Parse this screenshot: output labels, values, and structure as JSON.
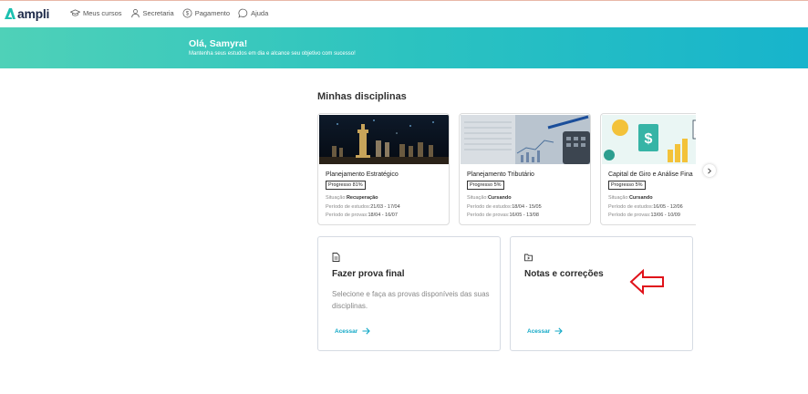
{
  "app": {
    "logo_text": "ampli"
  },
  "nav": {
    "items": [
      {
        "label": "Meus cursos",
        "icon": "graduation-cap-icon"
      },
      {
        "label": "Secretaria",
        "icon": "user-icon"
      },
      {
        "label": "Pagamento",
        "icon": "dollar-circle-icon"
      },
      {
        "label": "Ajuda",
        "icon": "chat-bubble-icon"
      }
    ]
  },
  "hero": {
    "title": "Olá, Samyra!",
    "subtitle": "Mantenha seus estudos em dia e alcance seu objetivo com sucesso!"
  },
  "disciplines": {
    "title": "Minhas disciplinas",
    "cards": [
      {
        "name": "Planejamento Estratégico",
        "progress": "Progresso 81%",
        "status_label": "Situação:",
        "status_value": "Recuperação",
        "study_label": "Período de estudos:",
        "study_value": "21/03 - 17/04",
        "exam_label": "Período de provas:",
        "exam_value": "18/04 - 16/07"
      },
      {
        "name": "Planejamento Tributário",
        "progress": "Progresso 5%",
        "status_label": "Situação:",
        "status_value": "Cursando",
        "study_label": "Período de estudos:",
        "study_value": "18/04 - 15/05",
        "exam_label": "Período de provas:",
        "exam_value": "16/05 - 13/08"
      },
      {
        "name": "Capital de Giro e Análise Fina",
        "progress": "Progresso 5%",
        "status_label": "Situação:",
        "status_value": "Cursando",
        "study_label": "Período de estudos:",
        "study_value": "16/05 - 12/06",
        "exam_label": "Período de provas:",
        "exam_value": "13/06 - 10/09"
      }
    ],
    "next_icon": "chevron-right-icon"
  },
  "actions": [
    {
      "icon": "document-icon",
      "title": "Fazer prova final",
      "description": "Selecione e faça as provas disponíveis das suas disciplinas.",
      "link": "Acessar"
    },
    {
      "icon": "folder-icon",
      "title": "Notas e correções",
      "description": "",
      "link": "Acessar"
    }
  ],
  "colors": {
    "accent": "#13a9c7",
    "hero_start": "#4fd1b8",
    "hero_end": "#17b4cc",
    "annotation_arrow": "#e0121a"
  }
}
